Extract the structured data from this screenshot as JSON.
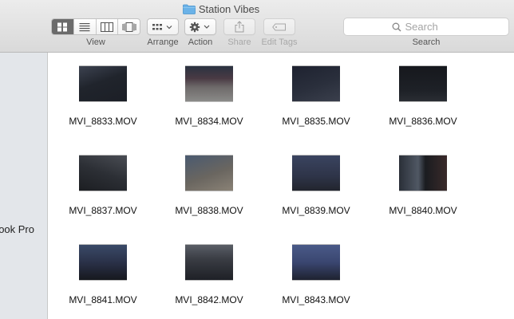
{
  "window": {
    "title": "Station Vibes"
  },
  "toolbar": {
    "view_label": "View",
    "arrange_label": "Arrange",
    "action_label": "Action",
    "share_label": "Share",
    "edit_tags_label": "Edit Tags",
    "search_label": "Search",
    "search_placeholder": "Search",
    "active_view": "icon"
  },
  "sidebar": {
    "device_label": "ook Pro"
  },
  "files": [
    {
      "name": "MVI_8833.MOV"
    },
    {
      "name": "MVI_8834.MOV"
    },
    {
      "name": "MVI_8835.MOV"
    },
    {
      "name": "MVI_8836.MOV"
    },
    {
      "name": "MVI_8837.MOV"
    },
    {
      "name": "MVI_8838.MOV"
    },
    {
      "name": "MVI_8839.MOV"
    },
    {
      "name": "MVI_8840.MOV"
    },
    {
      "name": "MVI_8841.MOV"
    },
    {
      "name": "MVI_8842.MOV"
    },
    {
      "name": "MVI_8843.MOV"
    }
  ],
  "colors": {
    "folder": "#6ab2e8",
    "active_segment": "#6b6b6b",
    "sidebar": "#e3e6ea"
  }
}
